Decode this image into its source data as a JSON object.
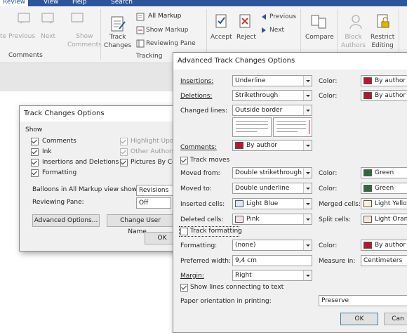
{
  "ribbon": {
    "tabs": [
      "Review",
      "View",
      "Help",
      "Search"
    ],
    "buttons": {
      "delete_partial": "te",
      "previous": "Previous",
      "next": "Next",
      "show_comments_1": "Show",
      "show_comments_2": "Comments",
      "track_changes_1": "Track",
      "track_changes_2": "Changes",
      "all_markup": "All Markup",
      "show_markup": "Show Markup",
      "reviewing_pane": "Reviewing Pane",
      "accept": "Accept",
      "reject": "Reject",
      "changes_previous": "Previous",
      "changes_next": "Next",
      "compare": "Compare",
      "block_authors_1": "Block",
      "block_authors_2": "Authors",
      "restrict_editing_1": "Restrict",
      "restrict_editing_2": "Editing"
    },
    "groups": {
      "comments": "Comments",
      "tracking": "Tracking"
    }
  },
  "tco": {
    "title": "Track Changes Options",
    "show_label": "Show",
    "items": [
      {
        "label": "Comments",
        "checked": true
      },
      {
        "label": "Ink",
        "checked": true
      },
      {
        "label": "Insertions and Deletions",
        "checked": true
      },
      {
        "label": "Formatting",
        "checked": true
      }
    ],
    "items_right": [
      {
        "label": "Highlight Upd",
        "checked": true
      },
      {
        "label": "Other Authors",
        "checked": true
      },
      {
        "label": "Pictures By Com",
        "checked": true
      }
    ],
    "balloons_label": "Balloons in All Markup view show:",
    "balloons_value": "Revisions",
    "reviewing_pane_label": "Reviewing Pane:",
    "reviewing_pane_value": "Off",
    "advanced_button": "Advanced Options...",
    "change_user_button": "Change User Name...",
    "ok": "OK"
  },
  "atco": {
    "title": "Advanced Track Changes Options",
    "insertions_label": "Insertions:",
    "insertions_value": "Underline",
    "deletions_label": "Deletions:",
    "deletions_value": "Strikethrough",
    "changed_lines_label": "Changed lines:",
    "changed_lines_value": "Outside border",
    "comments_label": "Comments:",
    "comments_value": "By author",
    "color_label": "Color:",
    "insertions_color": "By author",
    "deletions_color": "By author",
    "track_moves": "Track moves",
    "moved_from_label": "Moved from:",
    "moved_from_value": "Double strikethrough",
    "moved_from_color": "Green",
    "moved_to_label": "Moved to:",
    "moved_to_value": "Double underline",
    "moved_to_color": "Green",
    "inserted_cells_label": "Inserted cells:",
    "inserted_cells_value": "Light Blue",
    "merged_cells_label": "Merged cells:",
    "merged_cells_value": "Light Yellow",
    "deleted_cells_label": "Deleted cells:",
    "deleted_cells_value": "Pink",
    "split_cells_label": "Split cells:",
    "split_cells_value": "Light Orange",
    "track_formatting": "Track formatting",
    "formatting_label": "Formatting:",
    "formatting_value": "(none)",
    "formatting_color": "By author",
    "preferred_width_label": "Preferred width:",
    "preferred_width_value": "9,4 cm",
    "measure_in_label": "Measure in:",
    "measure_in_value": "Centimeters",
    "margin_label": "Margin:",
    "margin_value": "Right",
    "show_lines": "Show lines connecting to text",
    "paper_orientation_label": "Paper orientation in printing:",
    "paper_orientation_value": "Preserve",
    "ok": "OK",
    "cancel": "Can"
  },
  "colors": {
    "by_author": "#b5172e",
    "green": "#2e6b3a",
    "light_blue": "#dbe7f7",
    "pink": "#f9dfe8",
    "light_yellow": "#fbf2d5",
    "light_orange": "#fbe5d2",
    "accent": "#2b579a"
  }
}
